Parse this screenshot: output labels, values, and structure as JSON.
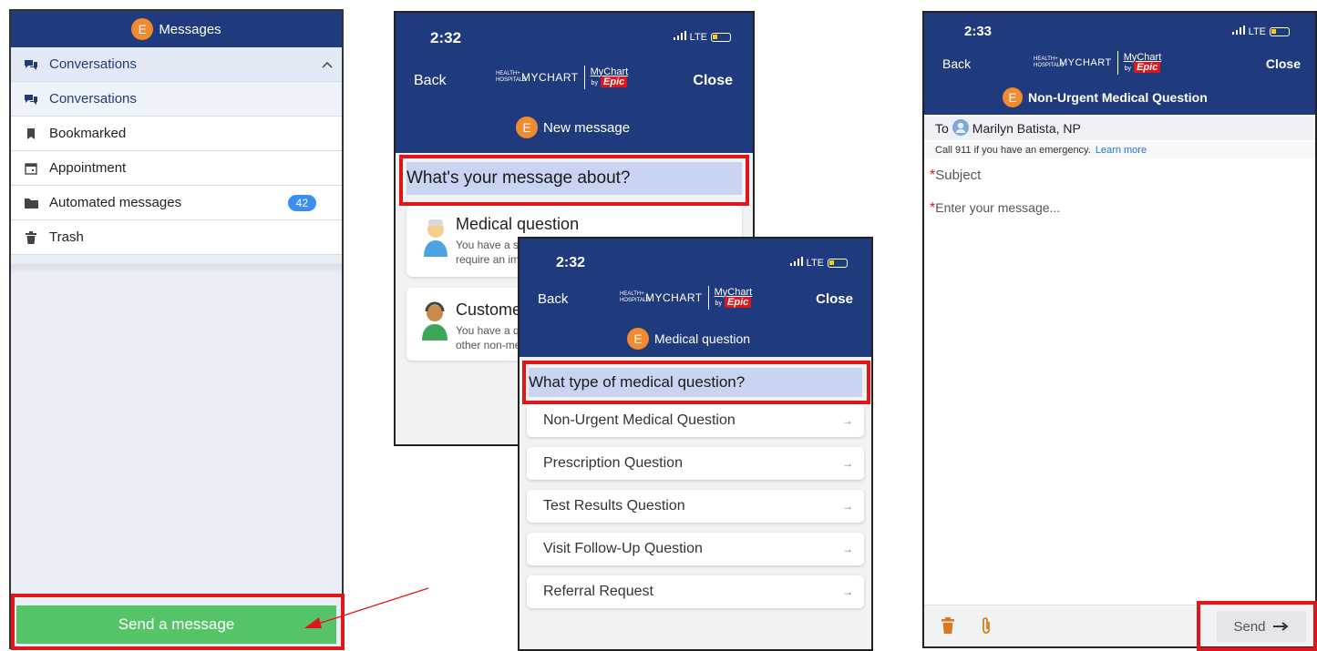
{
  "screen1": {
    "title": "Messages",
    "avatar_letter": "E",
    "section_header": "Conversations",
    "items": [
      {
        "label": "Conversations",
        "icon": "chat-bubbles-icon"
      },
      {
        "label": "Bookmarked",
        "icon": "bookmark-icon"
      },
      {
        "label": "Appointment",
        "icon": "calendar-icon"
      },
      {
        "label": "Automated messages",
        "icon": "folder-icon",
        "count": "42"
      },
      {
        "label": "Trash",
        "icon": "trash-icon"
      }
    ],
    "send_button": "Send a message"
  },
  "screen2": {
    "time": "2:32",
    "network": "LTE",
    "back": "Back",
    "close": "Close",
    "logo_small": "HEALTH+ HOSPITALS",
    "logo_mychart": "MYCHART",
    "logo_mychart_script": "MyChart",
    "logo_by": "by",
    "logo_epic": "Epic",
    "avatar_letter": "E",
    "title": "New message",
    "question": "What's your message about?",
    "options": [
      {
        "title": "Medical question",
        "desc1": "You have a s",
        "desc2": "require an im"
      },
      {
        "title": "Custome",
        "desc1": "You have a q",
        "desc2": "other non-me"
      }
    ]
  },
  "screen3": {
    "time": "2:32",
    "network": "LTE",
    "back": "Back",
    "close": "Close",
    "logo_small": "HEALTH+ HOSPITALS",
    "logo_mychart": "MYCHART",
    "logo_mychart_script": "MyChart",
    "logo_by": "by",
    "logo_epic": "Epic",
    "avatar_letter": "E",
    "title": "Medical question",
    "question": "What type of medical question?",
    "options": [
      "Non-Urgent Medical Question",
      "Prescription Question",
      "Test Results Question",
      "Visit Follow-Up Question",
      "Referral Request"
    ],
    "arrow": "→"
  },
  "screen4": {
    "time": "2:33",
    "network": "LTE",
    "back": "Back",
    "close": "Close",
    "logo_small": "HEALTH+ HOSPITALS",
    "logo_mychart": "MYCHART",
    "logo_mychart_script": "MyChart",
    "logo_by": "by",
    "logo_epic": "Epic",
    "avatar_letter": "E",
    "title": "Non-Urgent Medical Question",
    "to_label": "To",
    "recipient": "Marilyn Batista, NP",
    "emergency_note": "Call 911 if you have an emergency.",
    "learn_more": "Learn more",
    "required_mark": "*",
    "subject_placeholder": "Subject",
    "message_placeholder": "Enter your message...",
    "send": "Send"
  },
  "colors": {
    "navy": "#1f3a7d",
    "highlight": "#e0161b",
    "send_green": "#55c468",
    "badge_orange": "#f28b30",
    "count_blue": "#3c8ef0"
  }
}
